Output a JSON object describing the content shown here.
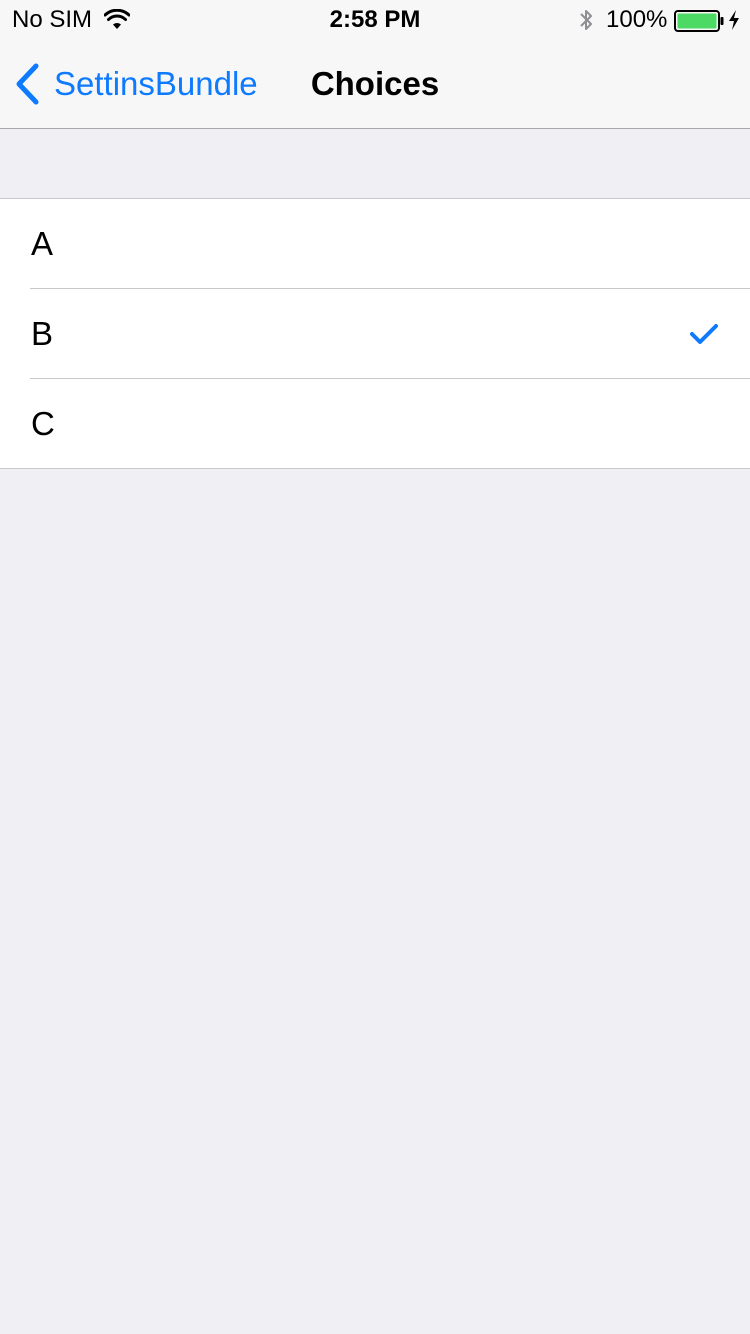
{
  "status_bar": {
    "carrier": "No SIM",
    "time": "2:58 PM",
    "battery_percent": "100%",
    "icons": [
      "wifi-icon",
      "bluetooth-icon",
      "battery-icon",
      "charging-icon"
    ],
    "battery_level": 1.0,
    "battery_color": "#4cd964"
  },
  "nav_bar": {
    "back_label": "SettinsBundle",
    "title": "Choices",
    "accent_color": "#0e7afe"
  },
  "choices": {
    "items": [
      {
        "label": "A",
        "selected": false
      },
      {
        "label": "B",
        "selected": true
      },
      {
        "label": "C",
        "selected": false
      }
    ]
  }
}
